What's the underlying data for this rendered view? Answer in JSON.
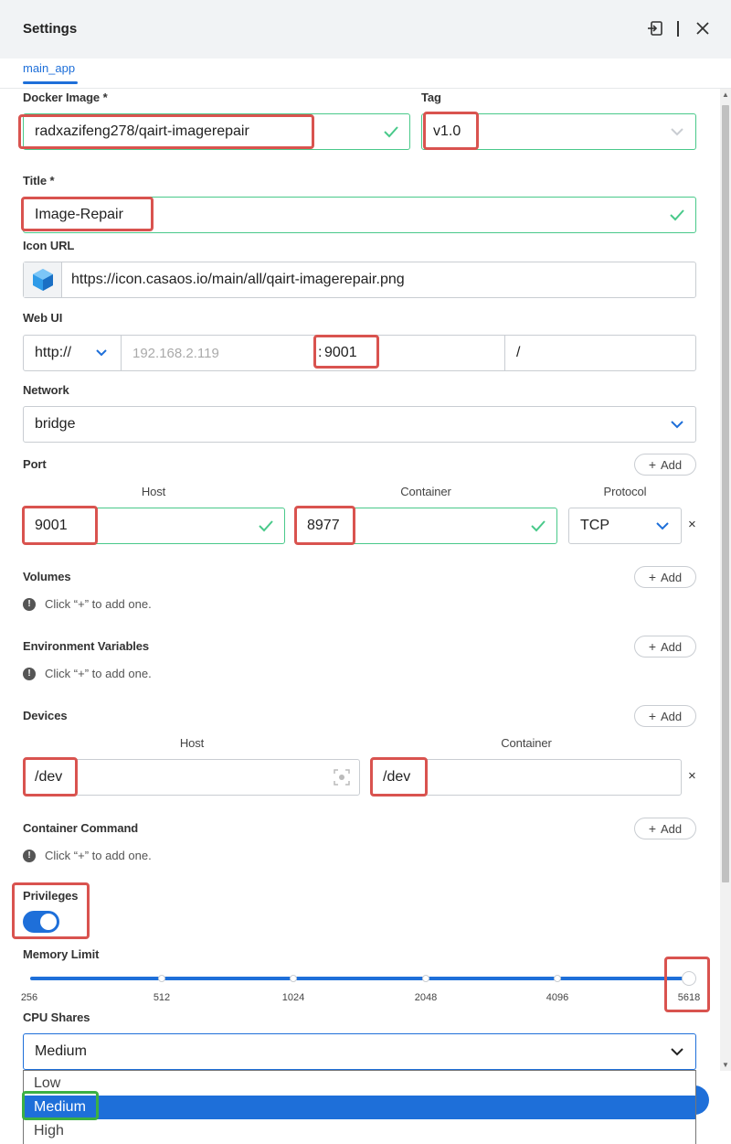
{
  "header": {
    "title": "Settings"
  },
  "tabs": [
    {
      "label": "main_app"
    }
  ],
  "docker_image": {
    "label": "Docker Image *",
    "value": "radxazifeng278/qairt-imagerepair"
  },
  "tag": {
    "label": "Tag",
    "value": "v1.0"
  },
  "title_field": {
    "label": "Title *",
    "value": "Image-Repair"
  },
  "icon_url": {
    "label": "Icon URL",
    "value": "https://icon.casaos.io/main/all/qairt-imagerepair.png"
  },
  "web_ui": {
    "label": "Web UI",
    "scheme": "http://",
    "host_placeholder": "192.168.2.119",
    "port_prefix": ":",
    "port": "9001",
    "path": "/"
  },
  "network": {
    "label": "Network",
    "value": "bridge"
  },
  "port": {
    "label": "Port",
    "add_label": "Add",
    "host_header": "Host",
    "container_header": "Container",
    "protocol_header": "Protocol",
    "host": "9001",
    "container": "8977",
    "protocol": "TCP"
  },
  "volumes": {
    "label": "Volumes",
    "add_label": "Add",
    "hint": "Click “+” to add one."
  },
  "env_vars": {
    "label": "Environment Variables",
    "add_label": "Add",
    "hint": "Click “+” to add one."
  },
  "devices": {
    "label": "Devices",
    "add_label": "Add",
    "host_header": "Host",
    "container_header": "Container",
    "host": "/dev",
    "container": "/dev"
  },
  "container_command": {
    "label": "Container Command",
    "add_label": "Add",
    "hint": "Click “+” to add one."
  },
  "privileges": {
    "label": "Privileges",
    "enabled": true
  },
  "memory_limit": {
    "label": "Memory Limit",
    "ticks": [
      "256",
      "512",
      "1024",
      "2048",
      "4096",
      "5618"
    ],
    "value": 5618
  },
  "cpu_shares": {
    "label": "CPU Shares",
    "value": "Medium",
    "options": [
      "Low",
      "Medium",
      "High"
    ]
  },
  "colors": {
    "accent": "#1e6fd9",
    "ok": "#49c98a",
    "highlight_red": "#d9534f",
    "highlight_green": "#3cb043"
  },
  "icons": [
    "export-icon",
    "close-icon",
    "check-icon",
    "chevron-down-icon",
    "cube-app-icon",
    "scan-icon",
    "exclamation-icon"
  ]
}
